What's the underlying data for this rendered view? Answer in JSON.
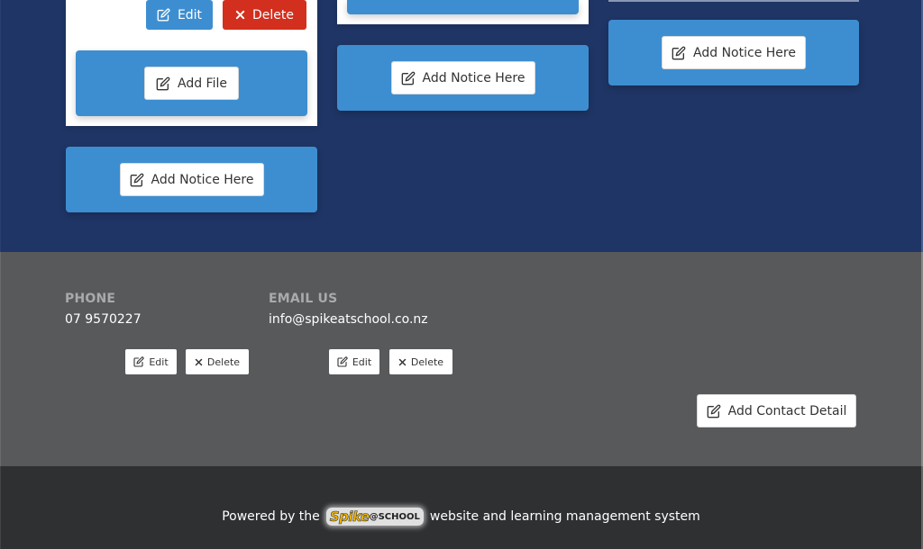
{
  "notices": {
    "column1": {
      "edit_label": "Edit",
      "delete_label": "Delete",
      "add_file_label": "Add File",
      "add_notice_label": "Add Notice Here"
    },
    "column2": {
      "add_notice_label": "Add Notice Here"
    },
    "column3": {
      "add_notice_label": "Add Notice Here"
    }
  },
  "contact": {
    "items": [
      {
        "label": "PHONE",
        "value": "07 9570227",
        "edit_label": "Edit",
        "delete_label": "Delete"
      },
      {
        "label": "EMAIL US",
        "value": "info@spikeatschool.co.nz",
        "edit_label": "Edit",
        "delete_label": "Delete"
      }
    ],
    "add_contact_label": "Add Contact Detail"
  },
  "footer": {
    "prefix": "Powered by the",
    "logo_spike": "Spike",
    "logo_school": "@SCHOOL",
    "suffix": "website and learning management system"
  },
  "colors": {
    "main_bg": "#1f3565",
    "accent_blue": "#3d8ed1",
    "delete_red": "#d32f1e",
    "contact_bg": "#58595b",
    "footer_bg": "#2f3032"
  }
}
